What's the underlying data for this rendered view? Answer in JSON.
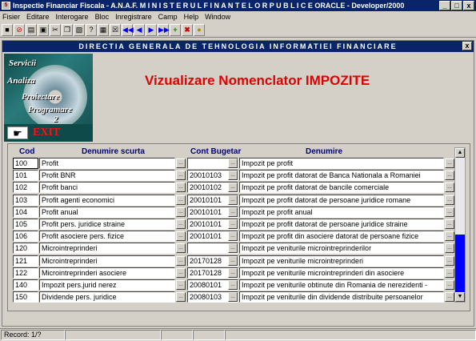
{
  "window": {
    "title": "Inspectie Financiar Fiscala - A.N.A.F.  M I N I S T E R U L   F I N A N T E L O R   P U B L I C E  ORACLE - Developer/2000",
    "controls": [
      "_",
      "□",
      "x"
    ]
  },
  "menu": [
    "Fisier",
    "Editare",
    "Interogare",
    "Bloc",
    "Inregistrare",
    "Camp",
    "Help",
    "Window"
  ],
  "subwindow": {
    "title": "DIRECTIA GENERALA DE TEHNOLOGIA INFORMATIEI FINANCIARE",
    "close": "x"
  },
  "logo": {
    "lines": [
      "Servicii",
      "Analiza",
      "Proiectare",
      "Programare",
      "2"
    ]
  },
  "exit": {
    "label": "EXIT"
  },
  "page_title": "Vizualizare Nomenclator IMPOZITE",
  "columns": {
    "cod": "Cod",
    "denumire_scurta": "Denumire scurta",
    "cont": "Cont Bugetar",
    "denumire": "Denumire"
  },
  "rows": [
    {
      "cod": "100",
      "short": "Profit",
      "cont": "",
      "den": "Impozit pe profit"
    },
    {
      "cod": "101",
      "short": "Profit BNR",
      "cont": "20010103",
      "den": "Impozit pe profit datorat de Banca Nationala a Romaniei"
    },
    {
      "cod": "102",
      "short": "Profit banci",
      "cont": "20010102",
      "den": "Impozit pe profit datorat de  bancile comerciale"
    },
    {
      "cod": "103",
      "short": "Profit agenti economici",
      "cont": "20010101",
      "den": "Impozit pe profit datorat de persoane juridice romane"
    },
    {
      "cod": "104",
      "short": "Profit anual",
      "cont": "20010101",
      "den": "Impozit pe profit anual"
    },
    {
      "cod": "105",
      "short": "Profit pers. juridice straine",
      "cont": "20010101",
      "den": "Impozit pe profit datorat de persoane juridice straine"
    },
    {
      "cod": "106",
      "short": "Profit asociere pers. fizice",
      "cont": "20010101",
      "den": "Impozit pe profit din asociere datorat de persoane fizice"
    },
    {
      "cod": "120",
      "short": "Microintreprinderi",
      "cont": "",
      "den": "Impozit pe veniturile microintreprinderilor"
    },
    {
      "cod": "121",
      "short": "Microintreprinderi",
      "cont": "20170128",
      "den": "Impozit pe veniturile microintreprinderi"
    },
    {
      "cod": "122",
      "short": "Microintreprinderi asociere",
      "cont": "20170128",
      "den": "Impozit pe veniturile microintreprinderi din asociere"
    },
    {
      "cod": "140",
      "short": "Impozit pers.jurid nerez",
      "cont": "20080101",
      "den": "Impozit pe veniturile obtinute din Romania de nerezidenti -"
    },
    {
      "cod": "150",
      "short": "Dividende pers. juridice",
      "cont": "20080103",
      "den": "Impozit pe veniturile din dividende distribuite persoanelor"
    }
  ],
  "status": {
    "record": "Record: 1/?"
  }
}
